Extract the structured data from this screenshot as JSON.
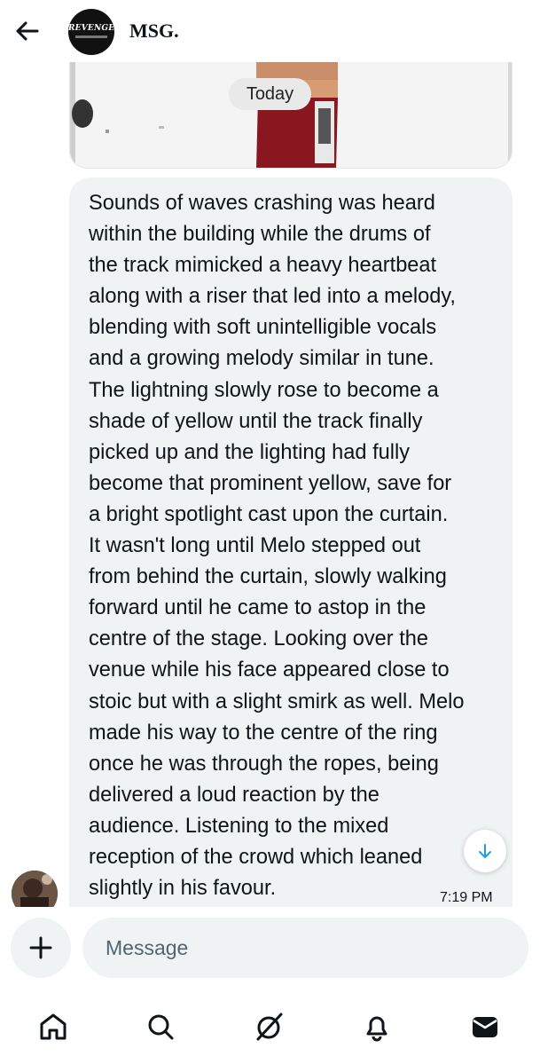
{
  "header": {
    "back_icon": "arrow-left-icon",
    "logo_text": "REVENGE",
    "title": "MSG."
  },
  "media": {
    "date_label": "Today"
  },
  "message": {
    "lines": [
      "Sounds of waves crashing was heard",
      "within the building while the drums of",
      "the track mimicked a heavy heartbeat",
      "along with a riser that led into a melody,",
      "blending with soft unintelligible vocals",
      "and a growing melody similar in tune.",
      "The lightning slowly rose to become a",
      "shade of yellow until the track finally",
      "picked up and the lighting had fully",
      "become that prominent yellow, save for",
      "a bright spotlight cast upon the curtain.",
      "It wasn't long until Melo stepped out",
      "from behind the curtain, slowly walking",
      "forward until he came to astop in the",
      "centre of the stage. Looking over the",
      "venue while his face appeared close to",
      "stoic but with a slight smirk as well. Melo",
      "made his way to the centre of the ring",
      "once he was through the ropes, being",
      "delivered a loud reaction by the",
      "audience. Listening to the mixed",
      "reception of the crowd which leaned",
      "slightly in his favour."
    ],
    "time": "7:19 PM"
  },
  "composer": {
    "placeholder": "Message",
    "plus_icon": "plus-icon"
  },
  "nav": {
    "items": [
      "home-icon",
      "search-icon",
      "grok-icon",
      "notifications-icon",
      "messages-icon"
    ]
  },
  "colors": {
    "bubble": "#eff3f4",
    "accent": "#1d9bf0",
    "text": "#0f1419",
    "muted": "#536471"
  }
}
